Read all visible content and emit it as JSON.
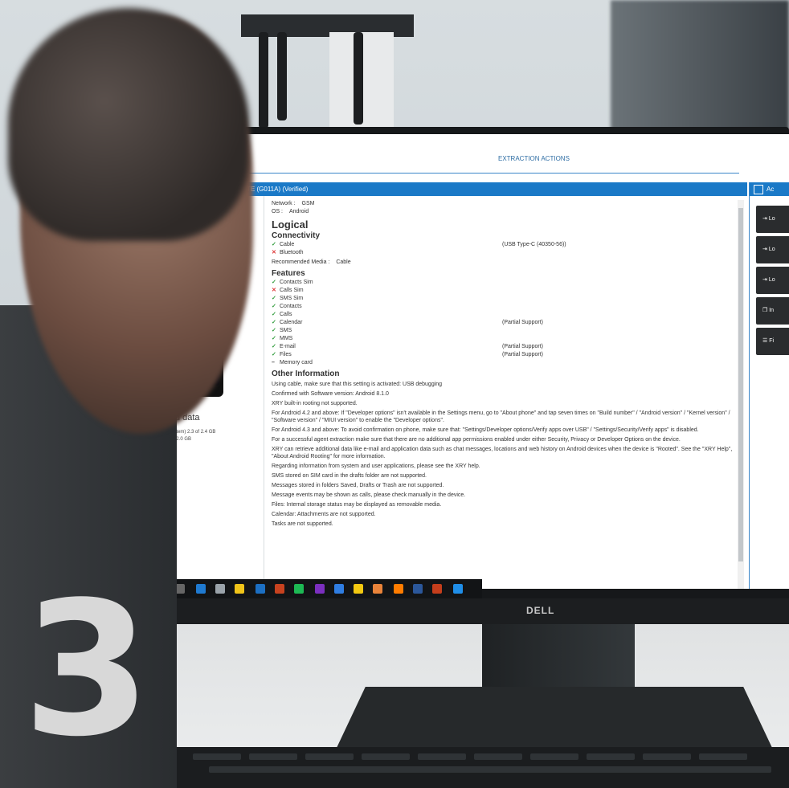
{
  "screen": {
    "title": "EXTRACTION ACTIONS",
    "device_header": "l TD-LTE (G011A) (Verified)",
    "scanned_data": {
      "title": "canned data",
      "line1": "s usage: (system) 2.3 of 2.4 GB",
      "line2": "ata) 48.8 of 52.0 GB"
    },
    "network_label": "Network :",
    "network_value": "GSM",
    "os_label": "OS :",
    "os_value": "Android",
    "logical_heading": "Logical",
    "connectivity_heading": "Connectivity",
    "connectivity": [
      {
        "status": "ok",
        "label": "Cable",
        "note": "(USB Type-C (40350-56))"
      },
      {
        "status": "no",
        "label": "Bluetooth",
        "note": ""
      }
    ],
    "recommended_media_label": "Recommended Media :",
    "recommended_media_value": "Cable",
    "features_heading": "Features",
    "features": [
      {
        "status": "ok",
        "label": "Contacts Sim",
        "note": ""
      },
      {
        "status": "no",
        "label": "Calls Sim",
        "note": ""
      },
      {
        "status": "ok",
        "label": "SMS Sim",
        "note": ""
      },
      {
        "status": "ok",
        "label": "Contacts",
        "note": ""
      },
      {
        "status": "ok",
        "label": "Calls",
        "note": ""
      },
      {
        "status": "ok",
        "label": "Calendar",
        "note": "(Partial Support)"
      },
      {
        "status": "ok",
        "label": "SMS",
        "note": ""
      },
      {
        "status": "ok",
        "label": "MMS",
        "note": ""
      },
      {
        "status": "ok",
        "label": "E-mail",
        "note": "(Partial Support)"
      },
      {
        "status": "ok",
        "label": "Files",
        "note": "(Partial Support)"
      },
      {
        "status": "dash",
        "label": "Memory card",
        "note": ""
      }
    ],
    "other_heading": "Other Information",
    "other_info": [
      "Using cable, make sure that this setting is activated: USB debugging",
      "Confirmed with Software version: Android 8.1.0",
      "XRY built-in rooting not supported.",
      "For Android 4.2 and above: If \"Developer options\" isn't available in the Settings menu, go to \"About phone\" and tap seven times on \"Build number\" / \"Android version\" / \"Kernel version\" / \"Software version\" / \"MIUI version\" to enable the \"Developer options\".",
      "For Android 4.3 and above: To avoid confirmation on phone, make sure that: \"Settings/Developer options/Verify apps over USB\" / \"Settings/Security/Verify apps\" is disabled.",
      "For a successful agent extraction make sure that there are no additional app permissions enabled under either Security, Privacy or Developer Options on the device.",
      "XRY can retrieve additional data like e-mail and application data such as chat messages, locations and web history on Android devices when the device is \"Rooted\". See the \"XRY Help\", \"About Android Rooting\" for more information.",
      "Regarding information from system and user applications, please see the XRY help.",
      "SMS stored on SIM card in the drafts folder are not supported.",
      "Messages stored in folders Saved, Drafts or Trash are not supported.",
      "Message events may be shown as calls, please check manually in the device.",
      "Files: Internal storage status may be displayed as removable media.",
      "Calendar: Attachments are not supported.",
      "Tasks are not supported."
    ],
    "actions_header": "Ac",
    "action_buttons": [
      "Lo",
      "Lo",
      "Lo",
      "In",
      "Fi"
    ]
  },
  "monitor_brand": "DELL",
  "jersey_number": "3",
  "colors": {
    "accent_blue": "#1a79c7",
    "ok_green": "#2e9b3a",
    "no_red": "#d33333"
  }
}
